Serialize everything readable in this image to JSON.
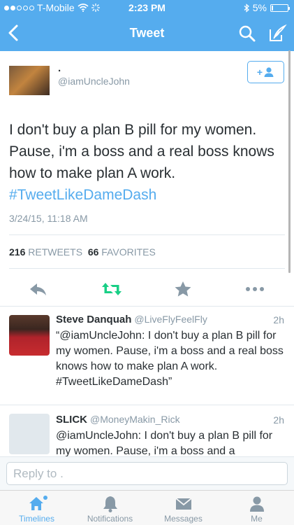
{
  "status_bar": {
    "carrier": "T-Mobile",
    "time": "2:23 PM",
    "battery": "5%",
    "battery_level": 0.05
  },
  "nav": {
    "title": "Tweet",
    "icons": [
      "back-chevron-icon",
      "search-icon",
      "compose-icon"
    ]
  },
  "tweet": {
    "display_name": ".",
    "handle": "@iamUncleJohn",
    "follow_label": "+",
    "text": "I don't buy a plan B pill for my women. Pause, i'm a boss and a real boss knows how to make plan A work.",
    "hashtag": "#TweetLikeDameDash",
    "date": "3/24/15, 11:18 AM",
    "retweet_count": "216",
    "retweet_label": "RETWEETS",
    "favorite_count": "66",
    "favorite_label": "FAVORITES",
    "actions": [
      "reply-icon",
      "retweet-icon",
      "favorite-icon",
      "more-icon"
    ]
  },
  "replies": [
    {
      "name": "Steve Danquah",
      "handle": "@LiveFlyFeelFly",
      "time": "2h",
      "text": "“@iamUncleJohn: I don't buy a plan B pill for my women. Pause, i'm a boss and a real boss knows how to make plan A work. #TweetLikeDameDash”"
    },
    {
      "name": "SLICK",
      "handle": "@MoneyMakin_Rick",
      "time": "2h",
      "text": "@iamUncleJohn: I don't buy a plan B pill for my women. Pause, i'm a boss and a"
    }
  ],
  "reply_box": {
    "placeholder": "Reply to ."
  },
  "tabs": [
    {
      "label": "Timelines",
      "icon": "home-icon",
      "active": true
    },
    {
      "label": "Notifications",
      "icon": "bell-icon",
      "active": false
    },
    {
      "label": "Messages",
      "icon": "envelope-icon",
      "active": false
    },
    {
      "label": "Me",
      "icon": "person-icon",
      "active": false
    }
  ],
  "colors": {
    "accent": "#55acee",
    "retweet_green": "#19cf86",
    "muted": "#8899a6",
    "text": "#292f33"
  }
}
